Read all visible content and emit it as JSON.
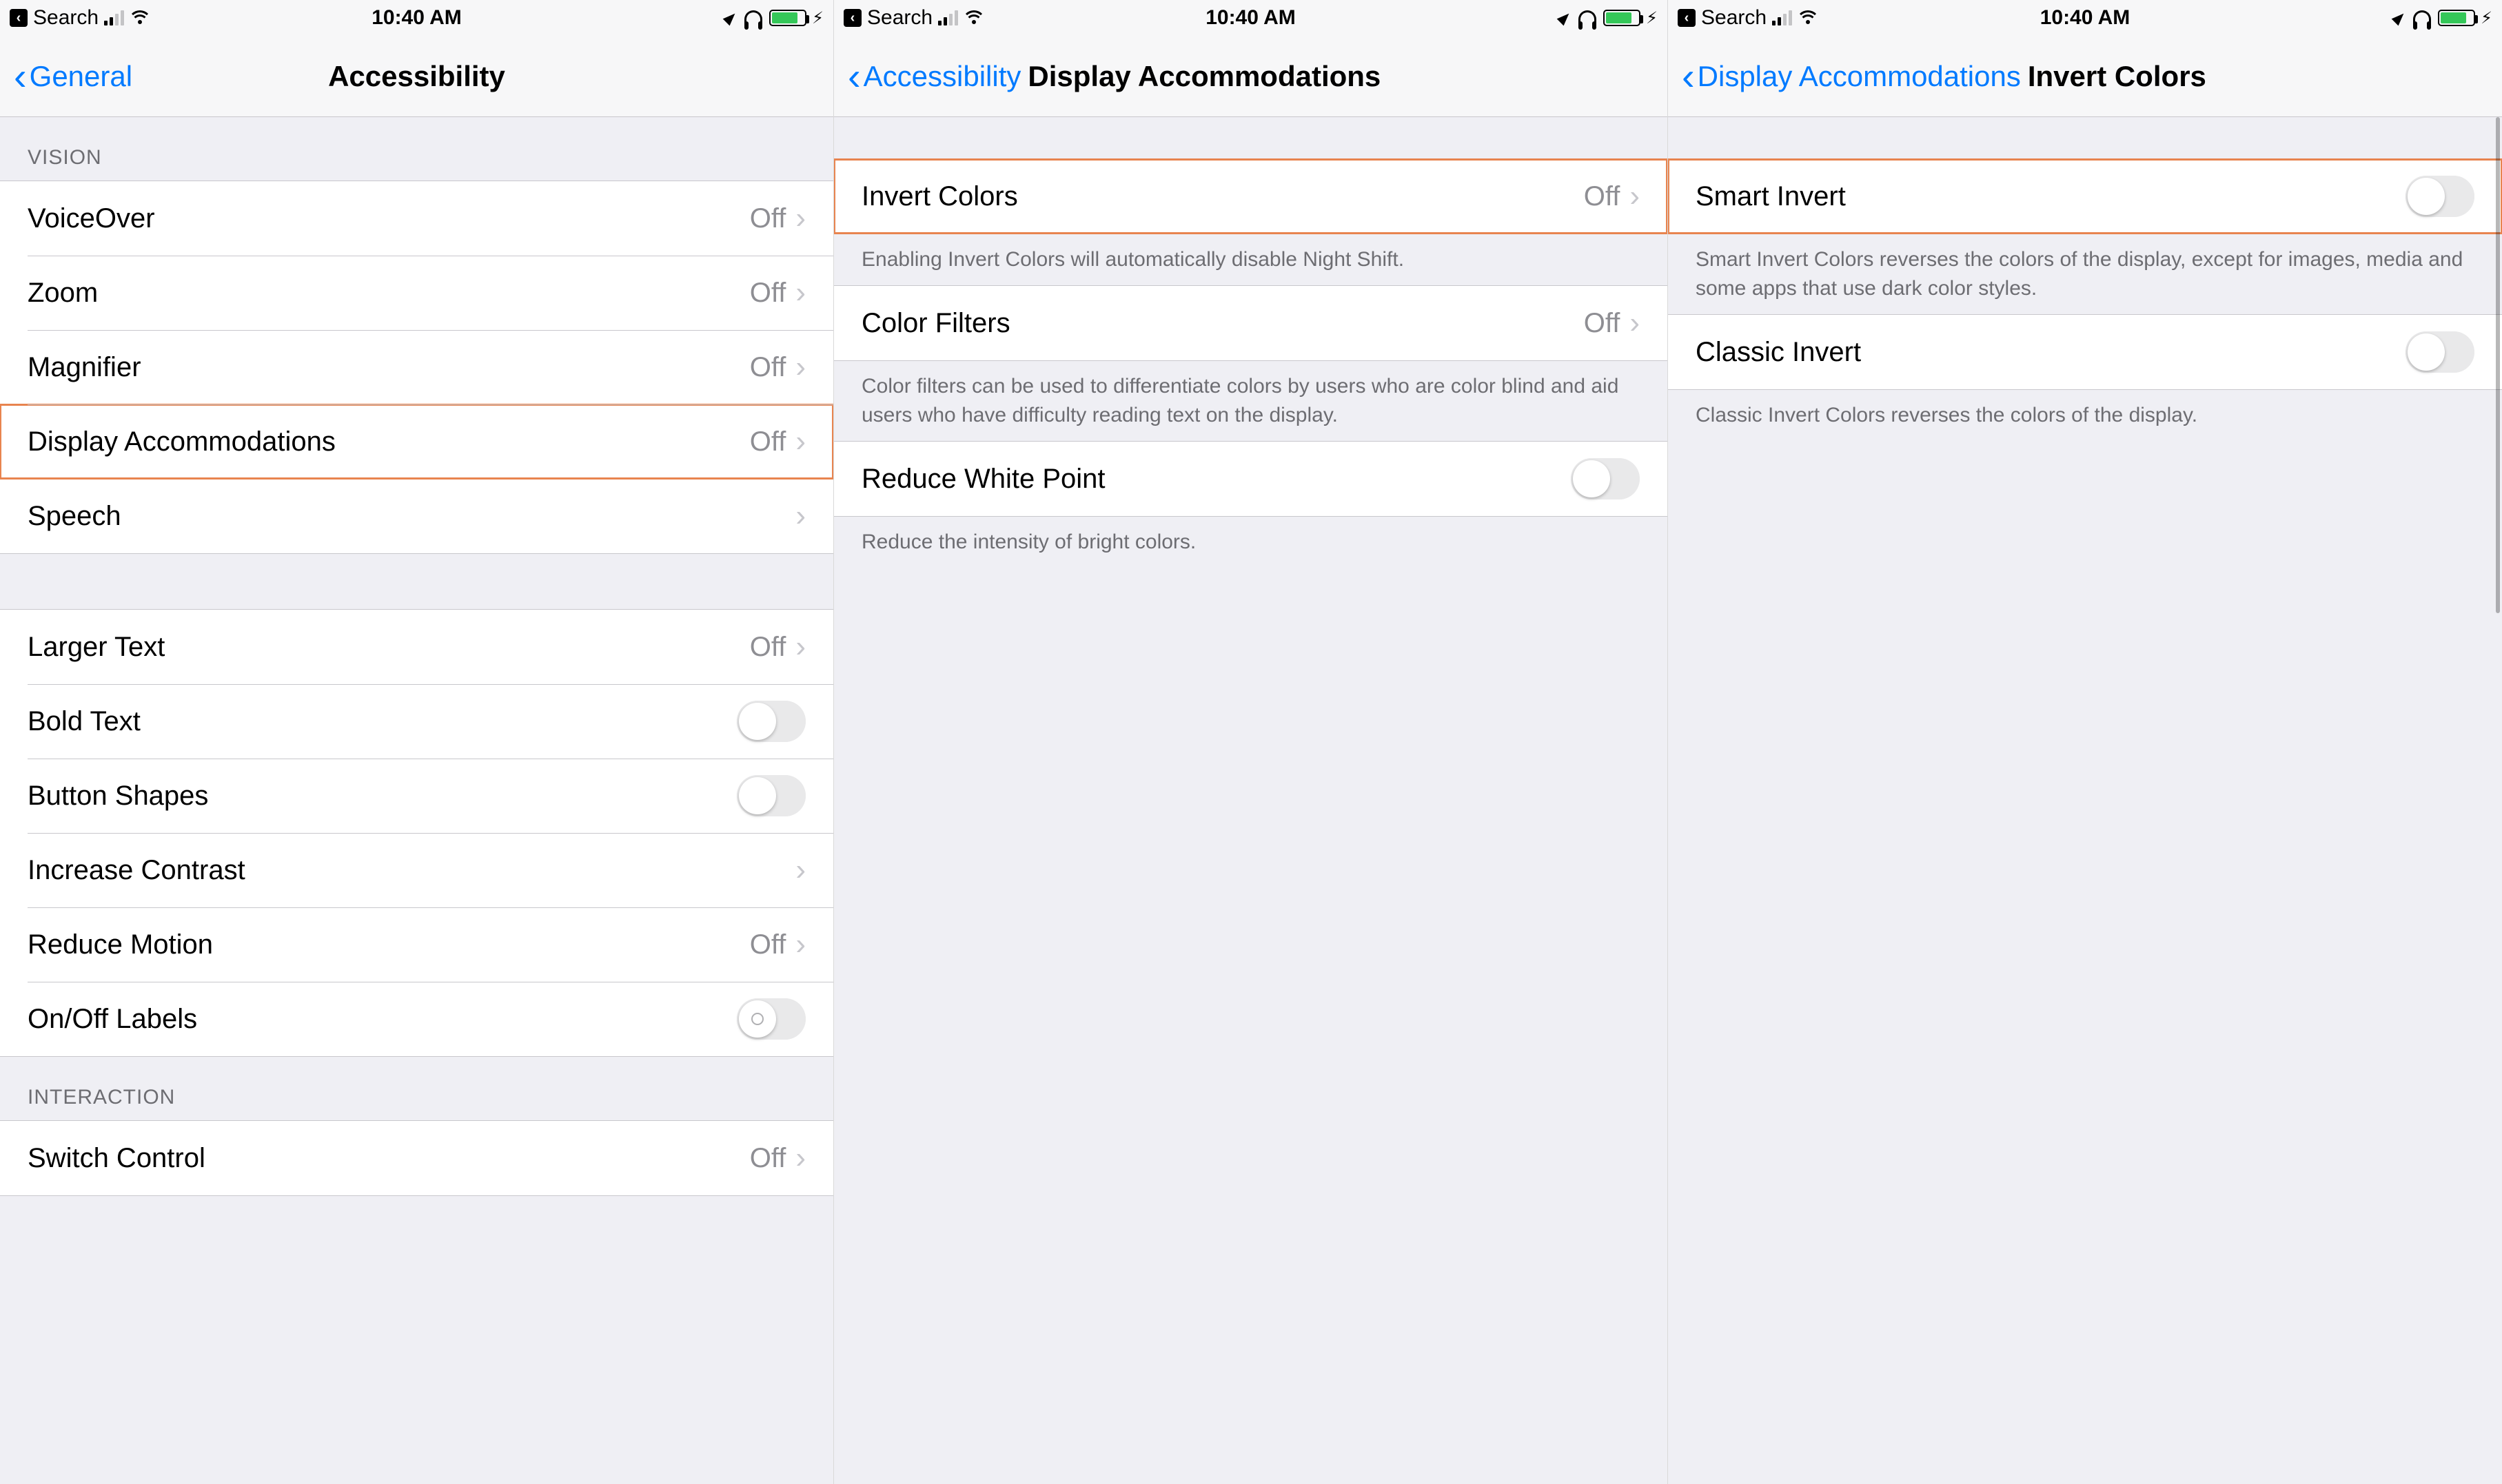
{
  "status": {
    "back_label": "Search",
    "time": "10:40 AM"
  },
  "screen1": {
    "back": "General",
    "title": "Accessibility",
    "headers": {
      "vision": "VISION",
      "interaction": "INTERACTION"
    },
    "rows": {
      "voiceover": {
        "label": "VoiceOver",
        "value": "Off"
      },
      "zoom": {
        "label": "Zoom",
        "value": "Off"
      },
      "magnifier": {
        "label": "Magnifier",
        "value": "Off"
      },
      "display_accom": {
        "label": "Display Accommodations",
        "value": "Off"
      },
      "speech": {
        "label": "Speech"
      },
      "larger_text": {
        "label": "Larger Text",
        "value": "Off"
      },
      "bold_text": {
        "label": "Bold Text"
      },
      "button_shapes": {
        "label": "Button Shapes"
      },
      "increase_contrast": {
        "label": "Increase Contrast"
      },
      "reduce_motion": {
        "label": "Reduce Motion",
        "value": "Off"
      },
      "onoff_labels": {
        "label": "On/Off Labels"
      },
      "switch_control": {
        "label": "Switch Control",
        "value": "Off"
      }
    }
  },
  "screen2": {
    "back": "Accessibility",
    "title": "Display Accommodations",
    "rows": {
      "invert_colors": {
        "label": "Invert Colors",
        "value": "Off"
      },
      "color_filters": {
        "label": "Color Filters",
        "value": "Off"
      },
      "reduce_white": {
        "label": "Reduce White Point"
      }
    },
    "footers": {
      "invert": "Enabling Invert Colors will automatically disable Night Shift.",
      "filters": "Color filters can be used to differentiate colors by users who are color blind and aid users who have difficulty reading text on the display.",
      "white": "Reduce the intensity of bright colors."
    }
  },
  "screen3": {
    "back": "Display Accommodations",
    "title": "Invert Colors",
    "rows": {
      "smart": {
        "label": "Smart Invert"
      },
      "classic": {
        "label": "Classic Invert"
      }
    },
    "footers": {
      "smart": "Smart Invert Colors reverses the colors of the display, except for images, media and some apps that use dark color styles.",
      "classic": "Classic Invert Colors reverses the colors of the display."
    }
  }
}
